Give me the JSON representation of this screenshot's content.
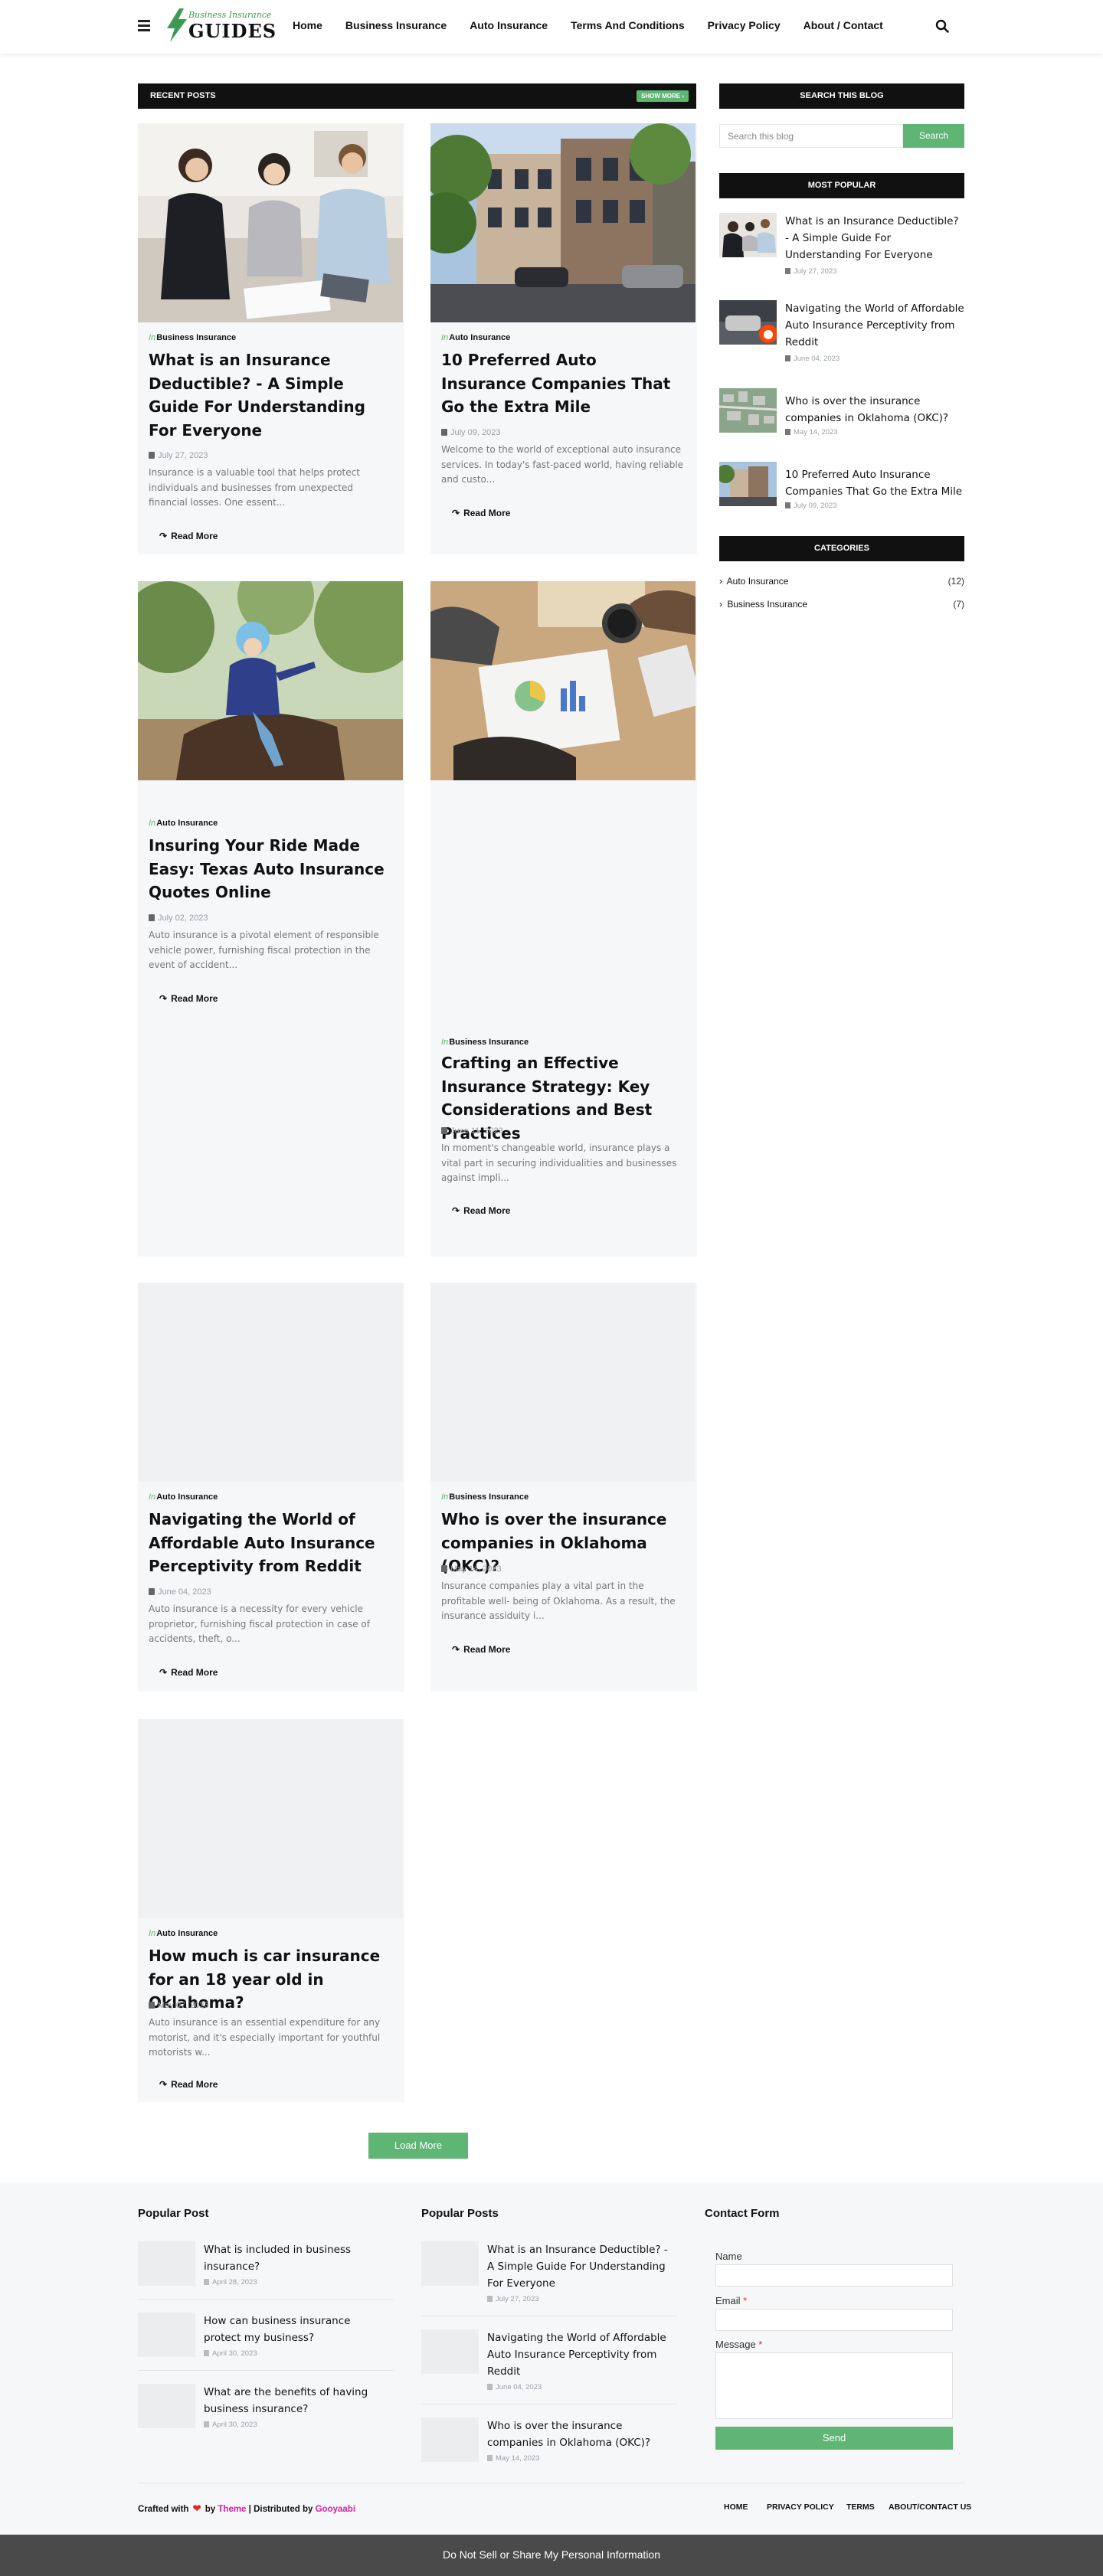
{
  "header": {
    "logo_top": "Business Insurance",
    "logo_main": "GUIDES",
    "nav": [
      "Home",
      "Business Insurance",
      "Auto Insurance",
      "Terms And Conditions",
      "Privacy Policy",
      "About / Contact"
    ]
  },
  "main": {
    "recent_title": "RECENT POSTS",
    "show_more": "SHOW MORE ›",
    "in_label": "In",
    "read_more": "Read More",
    "posts": [
      {
        "category": "Business Insurance",
        "title": "What is an Insurance Deductible? - A Simple Guide For Understanding For Everyone",
        "date": "July 27, 2023",
        "excerpt": "Insurance is a valuable tool that helps protect individuals and businesses from unexpected financial losses. One essent..."
      },
      {
        "category": "Auto Insurance",
        "title": "10 Preferred Auto Insurance Companies That Go the Extra Mile",
        "date": "July 09, 2023",
        "excerpt": "Welcome to the world of exceptional auto insurance services. In today's fast-paced world, having reliable and custo..."
      },
      {
        "category": "Auto Insurance",
        "title": "Insuring Your Ride Made Easy: Texas Auto Insurance Quotes Online",
        "date": "July 02, 2023",
        "excerpt": "Auto insurance is a pivotal element of responsible vehicle power, furnishing fiscal protection in the event of accident..."
      },
      {
        "category": "Business Insurance",
        "title": "Crafting an Effective Insurance Strategy: Key Considerations and Best Practices",
        "date": "June 11, 2023",
        "excerpt": "In moment's changeable world, insurance plays a vital part in securing individualities and businesses against impli..."
      },
      {
        "category": "Auto Insurance",
        "title": "Navigating the World of Affordable Auto Insurance Perceptivity from Reddit",
        "date": "June 04, 2023",
        "excerpt": "Auto insurance is a necessity for every vehicle proprietor, furnishing fiscal protection in case of accidents, theft, o..."
      },
      {
        "category": "Business Insurance",
        "title": "Who is over the insurance companies in Oklahoma (OKC)?",
        "date": "May 14, 2023",
        "excerpt": "Insurance companies play a vital part in the profitable well- being of Oklahoma. As a result, the insurance assiduity i..."
      },
      {
        "category": "Auto Insurance",
        "title": "How much is car insurance for an 18 year old in Oklahoma?",
        "date": "May 07, 2023",
        "excerpt": "Auto insurance is an essential expenditure for any motorist, and it's especially important for youthful motorists w..."
      }
    ],
    "load_more": "Load More"
  },
  "sidebar": {
    "search_title": "SEARCH THIS BLOG",
    "search_placeholder": "Search this blog",
    "search_button": "Search",
    "popular_title": "MOST POPULAR",
    "popular": [
      {
        "title": "What is an Insurance Deductible? - A Simple Guide For Understanding For Everyone",
        "date": "July 27, 2023"
      },
      {
        "title": "Navigating the World of Affordable Auto Insurance Perceptivity from Reddit",
        "date": "June 04, 2023"
      },
      {
        "title": "Who is over the insurance companies in Oklahoma (OKC)?",
        "date": "May 14, 2023"
      },
      {
        "title": "10 Preferred Auto Insurance Companies That Go the Extra Mile",
        "date": "July 09, 2023"
      }
    ],
    "categories_title": "CATEGORIES",
    "categories": [
      {
        "name": "Auto Insurance",
        "count": "(12)"
      },
      {
        "name": "Business Insurance",
        "count": "(7)"
      }
    ]
  },
  "footer": {
    "col1_title": "Popular Post",
    "col1": [
      {
        "title": "What is included in business insurance?",
        "date": "April 28, 2023"
      },
      {
        "title": "How can business insurance protect my business?",
        "date": "April 30, 2023"
      },
      {
        "title": "What are the benefits of having business insurance?",
        "date": "April 30, 2023"
      }
    ],
    "col2_title": "Popular Posts",
    "col2": [
      {
        "title": "What is an Insurance Deductible? - A Simple Guide For Understanding For Everyone",
        "date": "July 27, 2023"
      },
      {
        "title": "Navigating the World of Affordable Auto Insurance Perceptivity from Reddit",
        "date": "June 04, 2023"
      },
      {
        "title": "Who is over the insurance companies in Oklahoma (OKC)?",
        "date": "May 14, 2023"
      }
    ],
    "contact_title": "Contact Form",
    "name_label": "Name",
    "email_label": "Email",
    "message_label": "Message",
    "required": "*",
    "send": "Send",
    "crafted": "Crafted with",
    "by": "by",
    "theme": "Theme",
    "distributed": "| Distributed by",
    "gooyaabi": "Gooyaabi",
    "links": [
      "HOME",
      "PRIVACY POLICY",
      "TERMS",
      "ABOUT/CONTACT US"
    ],
    "privacy_bar": "Do Not Sell or Share My Personal Information"
  },
  "colors": {
    "accent": "#5fb574",
    "dark": "#111111",
    "card_bg": "#f6f7f9",
    "bar": "#4a4a4a"
  }
}
